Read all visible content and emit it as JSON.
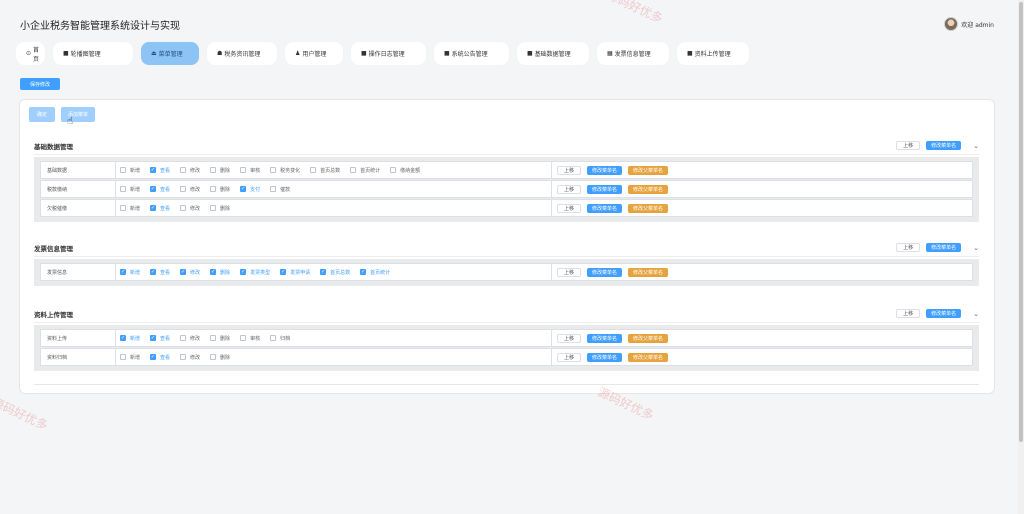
{
  "app": {
    "title": "小企业税务智能管理系统设计与实现",
    "user_greeting": "欢迎 admin"
  },
  "nav": [
    {
      "label": "首页",
      "icon": "home-icon",
      "glyph": "⊙"
    },
    {
      "label": "轮播图管理",
      "icon": "image-icon",
      "glyph": "■"
    },
    {
      "label": "菜单管理",
      "icon": "menu-icon",
      "glyph": "⏏"
    },
    {
      "label": "税务资讯管理",
      "icon": "news-icon",
      "glyph": "☗"
    },
    {
      "label": "用户管理",
      "icon": "user-icon",
      "glyph": "♟"
    },
    {
      "label": "操作日志管理",
      "icon": "log-icon",
      "glyph": "■"
    },
    {
      "label": "系统公告管理",
      "icon": "notice-icon",
      "glyph": "■"
    },
    {
      "label": "基础数据管理",
      "icon": "data-icon",
      "glyph": "■"
    },
    {
      "label": "发票信息管理",
      "icon": "invoice-icon",
      "glyph": "▦"
    },
    {
      "label": "资料上传管理",
      "icon": "upload-icon",
      "glyph": "■"
    }
  ],
  "toolbar": {
    "save_label": "保存修改"
  },
  "card_buttons": {
    "confirm": "确定",
    "add_menu": "添加菜单"
  },
  "row_buttons": {
    "up": "上移",
    "rename_menu": "修改菜单名",
    "rename_parent": "修改父菜单名"
  },
  "sections": [
    {
      "title": "基础数据管理",
      "rows": [
        {
          "label": "基础数据",
          "checks": [
            {
              "label": "新增",
              "checked": false
            },
            {
              "label": "查看",
              "checked": true
            },
            {
              "label": "修改",
              "checked": false
            },
            {
              "label": "删除",
              "checked": false
            },
            {
              "label": "审核",
              "checked": false
            },
            {
              "label": "税务变化",
              "checked": false
            },
            {
              "label": "首页总数",
              "checked": false
            },
            {
              "label": "首页统计",
              "checked": false
            },
            {
              "label": "缴纳金额",
              "checked": false
            }
          ]
        },
        {
          "label": "税款缴纳",
          "checks": [
            {
              "label": "新增",
              "checked": false
            },
            {
              "label": "查看",
              "checked": true
            },
            {
              "label": "修改",
              "checked": false
            },
            {
              "label": "删除",
              "checked": false
            },
            {
              "label": "支付",
              "checked": true
            },
            {
              "label": "催款",
              "checked": false
            }
          ]
        },
        {
          "label": "欠税催缴",
          "checks": [
            {
              "label": "新增",
              "checked": false
            },
            {
              "label": "查看",
              "checked": true
            },
            {
              "label": "修改",
              "checked": false
            },
            {
              "label": "删除",
              "checked": false
            }
          ]
        }
      ]
    },
    {
      "title": "发票信息管理",
      "rows": [
        {
          "label": "发票信息",
          "checks": [
            {
              "label": "新增",
              "checked": true
            },
            {
              "label": "查看",
              "checked": true
            },
            {
              "label": "修改",
              "checked": true
            },
            {
              "label": "删除",
              "checked": true
            },
            {
              "label": "发票类型",
              "checked": true
            },
            {
              "label": "发票申请",
              "checked": true
            },
            {
              "label": "首页总数",
              "checked": true
            },
            {
              "label": "首页统计",
              "checked": true
            }
          ]
        }
      ]
    },
    {
      "title": "资料上传管理",
      "rows": [
        {
          "label": "资料上传",
          "checks": [
            {
              "label": "新增",
              "checked": true
            },
            {
              "label": "查看",
              "checked": true
            },
            {
              "label": "修改",
              "checked": false
            },
            {
              "label": "删除",
              "checked": false
            },
            {
              "label": "审核",
              "checked": false
            },
            {
              "label": "归档",
              "checked": false
            }
          ]
        },
        {
          "label": "资料归档",
          "checks": [
            {
              "label": "新增",
              "checked": false
            },
            {
              "label": "查看",
              "checked": true
            },
            {
              "label": "修改",
              "checked": false
            },
            {
              "label": "删除",
              "checked": false
            }
          ]
        }
      ]
    }
  ],
  "watermark": "源码好优多",
  "colors": {
    "primary": "#409eff",
    "light": "#a0cfff",
    "warning": "#e6a23c",
    "nav_active": "#8bc4f5"
  }
}
